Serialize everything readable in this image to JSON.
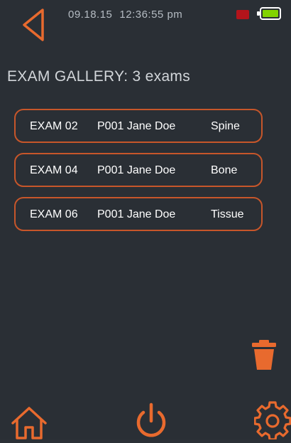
{
  "status_bar": {
    "date": "09.18.15",
    "time": "12:36:55 pm",
    "record_color": "#b3141b",
    "battery_color": "#82d400"
  },
  "icons": {
    "back": "left-triangle-icon",
    "trash": "trash-icon",
    "home": "home-icon",
    "power": "power-icon",
    "settings": "gear-icon"
  },
  "accent_color": "#e86a2e",
  "gallery": {
    "title": "EXAM GALLERY: 3 exams",
    "exams": [
      {
        "id": "EXAM 02",
        "patient": "P001 Jane Doe",
        "type": "Spine"
      },
      {
        "id": "EXAM 04",
        "patient": "P001 Jane Doe",
        "type": "Bone"
      },
      {
        "id": "EXAM 06",
        "patient": "P001 Jane Doe",
        "type": "Tissue"
      }
    ]
  }
}
